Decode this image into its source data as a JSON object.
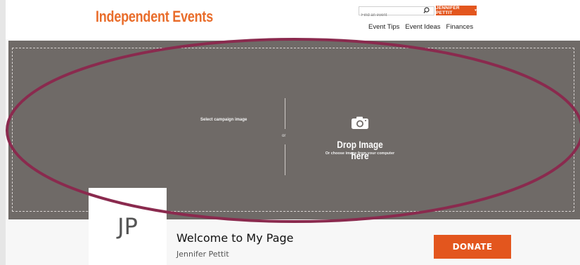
{
  "header": {
    "brand": "Independent Events",
    "search_placeholder": "Find an event",
    "user_label": "JENNIFER PETTIT",
    "nav": [
      "Event Tips",
      "Event Ideas",
      "Finances"
    ]
  },
  "banner": {
    "select_label": "Select campaign image",
    "or_text": "or",
    "drop_title": "Drop Image here",
    "drop_subtitle": "Or choose image from your computer"
  },
  "profile": {
    "initials": "JP",
    "welcome": "Welcome to My Page",
    "name": "Jennifer Pettit",
    "donate_label": "DONATE"
  },
  "colors": {
    "brand": "#e96d2b",
    "accent": "#e3561e",
    "banner": "#6f6a67",
    "annotation": "#8a2a4e"
  }
}
